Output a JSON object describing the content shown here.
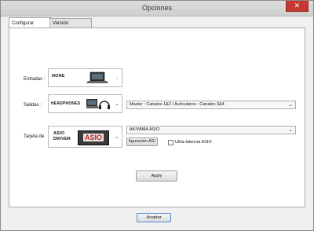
{
  "window": {
    "title": "Opciones",
    "close_glyph": "✕"
  },
  "tabs": [
    {
      "label": "Configurar Sonido",
      "active": true
    },
    {
      "label": "Versión Completa",
      "active": false
    }
  ],
  "rows": {
    "entradas": {
      "label": "Entradas :",
      "device_logo": "NONE",
      "icon": "laptop-icon"
    },
    "salidas": {
      "label": "Salidas :",
      "device_logo": "HEADPHONES",
      "icon": "headphones-icon",
      "selected": "Master : Canales 1&2 / Auriculares : Canales 3&4"
    },
    "tarjeta": {
      "label": "Tarjeta de",
      "device_logo_line1": "ASIO",
      "device_logo_line2": "DRIVER",
      "device_badge": "ASIO",
      "selected": "AKIYAMA ASIO",
      "config_button": "figuración ASI",
      "low_latency_label": "Ultra-latencia ASIO",
      "low_latency_checked": false
    }
  },
  "apply_label": "Apply",
  "accept_label": "Aceptar",
  "chevron": "⌄"
}
